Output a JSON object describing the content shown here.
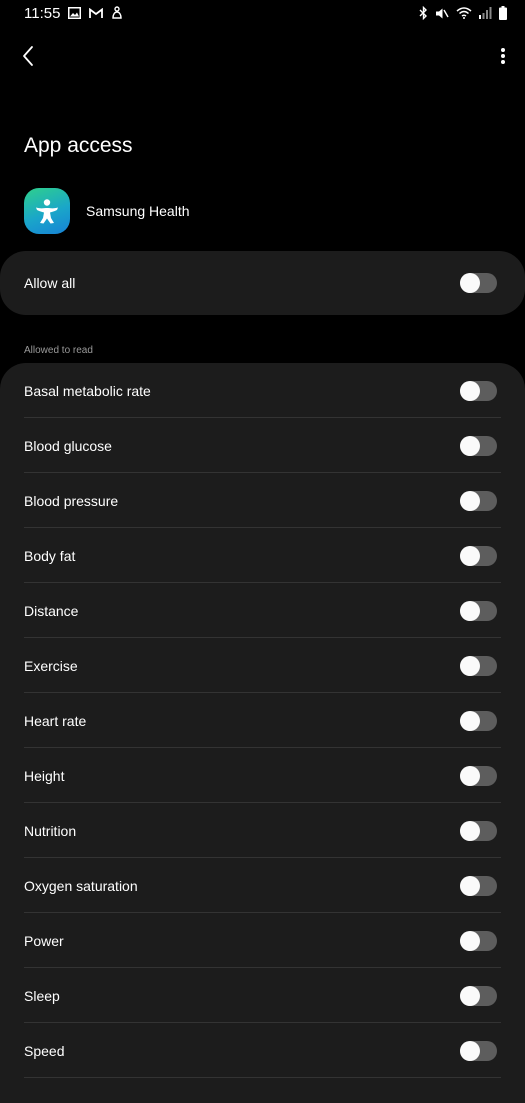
{
  "status_bar": {
    "time": "11:55",
    "left_icons": [
      "image-icon",
      "gmail-icon",
      "notification-icon"
    ],
    "right_icons": [
      "bluetooth-icon",
      "mute-icon",
      "wifi-icon",
      "signal-icon",
      "battery-icon"
    ]
  },
  "app_bar": {
    "back_icon": "back-chevron-icon",
    "more_icon": "more-vertical-icon"
  },
  "page": {
    "title": "App access"
  },
  "app": {
    "name": "Samsung Health",
    "icon": "samsung-health-icon"
  },
  "allow_all": {
    "label": "Allow all",
    "enabled": false
  },
  "section": {
    "header": "Allowed to read"
  },
  "permissions": [
    {
      "label": "Basal metabolic rate",
      "enabled": false
    },
    {
      "label": "Blood glucose",
      "enabled": false
    },
    {
      "label": "Blood pressure",
      "enabled": false
    },
    {
      "label": "Body fat",
      "enabled": false
    },
    {
      "label": "Distance",
      "enabled": false
    },
    {
      "label": "Exercise",
      "enabled": false
    },
    {
      "label": "Heart rate",
      "enabled": false
    },
    {
      "label": "Height",
      "enabled": false
    },
    {
      "label": "Nutrition",
      "enabled": false
    },
    {
      "label": "Oxygen saturation",
      "enabled": false
    },
    {
      "label": "Power",
      "enabled": false
    },
    {
      "label": "Sleep",
      "enabled": false
    },
    {
      "label": "Speed",
      "enabled": false
    }
  ],
  "colors": {
    "background": "#000000",
    "card": "#1c1c1c",
    "toggle_off_track": "#5d5d5d",
    "toggle_knob": "#fafafa",
    "section_header": "#9a9a9a"
  }
}
